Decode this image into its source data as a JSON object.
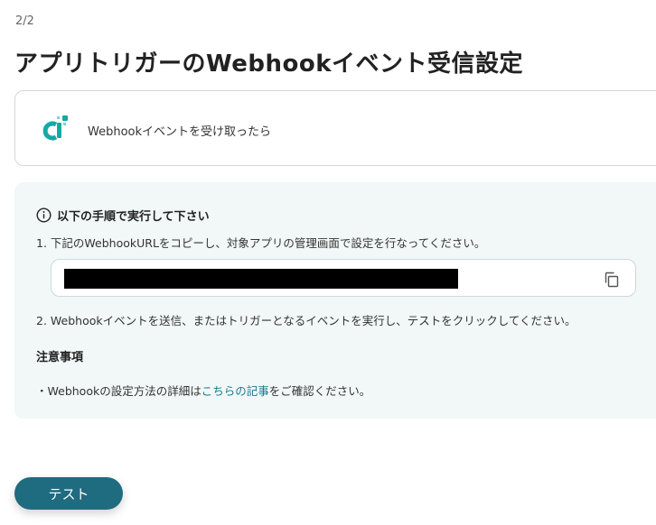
{
  "header": {
    "step": "2/2",
    "title": "アプリトリガーのWebhookイベント受信設定"
  },
  "trigger": {
    "app_icon": "yoom-app-logo",
    "label": "Webhookイベントを受け取ったら"
  },
  "instructions": {
    "icon": "info-icon",
    "heading": "以下の手順で実行して下さい",
    "step1": "1. 下記のWebhookURLをコピーし、対象アプリの管理画面で設定を行なってください。",
    "url_field": {
      "value": "",
      "copy_icon": "copy-icon"
    },
    "step2": "2. Webhookイベントを送信、またはトリガーとなるイベントを実行し、テストをクリックしてください。",
    "notes_heading": "注意事項",
    "note": {
      "prefix": "・Webhookの設定方法の詳細は",
      "link": "こちらの記事",
      "suffix": "をご確認ください。"
    }
  },
  "actions": {
    "test_label": "テスト"
  },
  "colors": {
    "accent": "#1f6b80",
    "link": "#1a7a8e",
    "panel_bg": "#f1f8f7",
    "logo_teal": "#15a9a5"
  }
}
